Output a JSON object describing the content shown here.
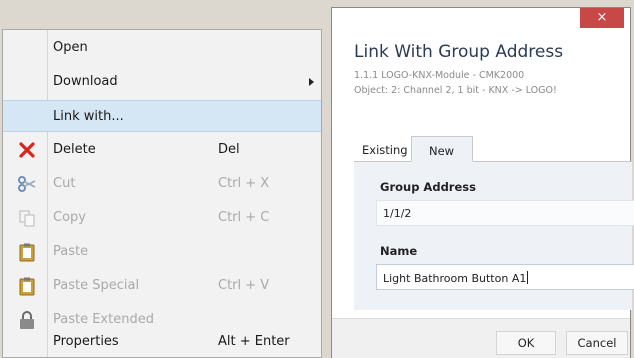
{
  "context_menu": {
    "items": [
      {
        "label": "Open",
        "shortcut": "",
        "icon": "",
        "disabled": false
      },
      {
        "label": "Download",
        "shortcut": "",
        "icon": "",
        "disabled": false,
        "submenu": true
      },
      {
        "label": "Link with...",
        "shortcut": "",
        "icon": "",
        "disabled": false,
        "highlighted": true
      },
      {
        "label": "Delete",
        "shortcut": "Del",
        "icon": "delete-x-icon",
        "disabled": false
      },
      {
        "label": "Cut",
        "shortcut": "Ctrl + X",
        "icon": "scissors-icon",
        "disabled": true
      },
      {
        "label": "Copy",
        "shortcut": "Ctrl + C",
        "icon": "copy-icon",
        "disabled": true
      },
      {
        "label": "Paste",
        "shortcut": "",
        "icon": "clipboard-icon",
        "disabled": true
      },
      {
        "label": "Paste Special",
        "shortcut": "Ctrl + V",
        "icon": "clipboard-icon",
        "disabled": true
      },
      {
        "label": "Paste Extended",
        "shortcut": "",
        "icon": "lock-icon",
        "disabled": true
      },
      {
        "label": "Properties",
        "shortcut": "Alt + Enter",
        "icon": "",
        "disabled": false
      }
    ]
  },
  "dialog": {
    "close_label": "×",
    "title": "Link With Group Address",
    "subtitle_line1": "1.1.1 LOGO-KNX-Module - CMK2000",
    "subtitle_line2": "Object: 2: Channel 2, 1 bit - KNX -> LOGO!",
    "tabs": [
      {
        "label": "Existing",
        "active": false
      },
      {
        "label": "New",
        "active": true
      }
    ],
    "group_address_label": "Group Address",
    "group_address_value": "1/1/2",
    "name_label": "Name",
    "name_value": "Light Bathroom Button A1",
    "ok_label": "OK",
    "cancel_label": "Cancel"
  },
  "colors": {
    "delete_icon": "#d9261c",
    "highlight": "#d5e6f5",
    "close_button": "#c84848",
    "dialog_title": "#2a3a55"
  }
}
